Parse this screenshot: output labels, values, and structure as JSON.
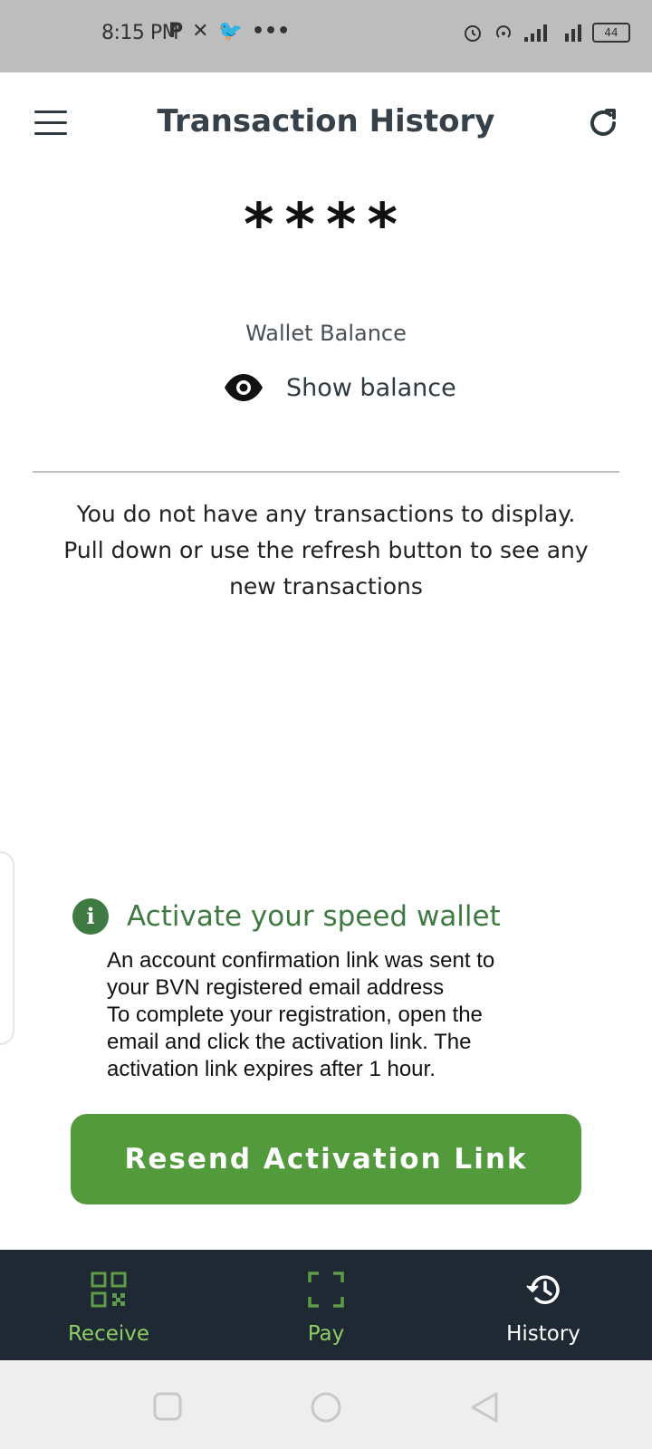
{
  "status_bar": {
    "time": "8:15 PM",
    "left_icons": [
      "p-icon",
      "x-icon",
      "twitter-icon",
      "more-dots-icon"
    ],
    "battery": "44"
  },
  "header": {
    "title": "Transaction History"
  },
  "balance": {
    "masked_value": "****",
    "label": "Wallet Balance",
    "toggle_label": "Show balance"
  },
  "transactions": {
    "empty_message": "You do not have any transactions to display. Pull down or use the refresh button to see any new transactions"
  },
  "activation": {
    "title": "Activate your speed wallet",
    "line1": "An account confirmation link was sent to",
    "line2": "your BVN registered email address",
    "line3": "To complete your registration, open the",
    "line4": "email and click the activation link. The",
    "line5": "activation link expires after 1 hour.",
    "button_label": "Resend Activation Link"
  },
  "bottom_nav": {
    "receive": "Receive",
    "pay": "Pay",
    "history": "History"
  },
  "colors": {
    "accent_green": "#529a3c",
    "nav_bg": "#1f2933",
    "nav_active": "#ffffff",
    "nav_inactive": "#8dcc63"
  }
}
